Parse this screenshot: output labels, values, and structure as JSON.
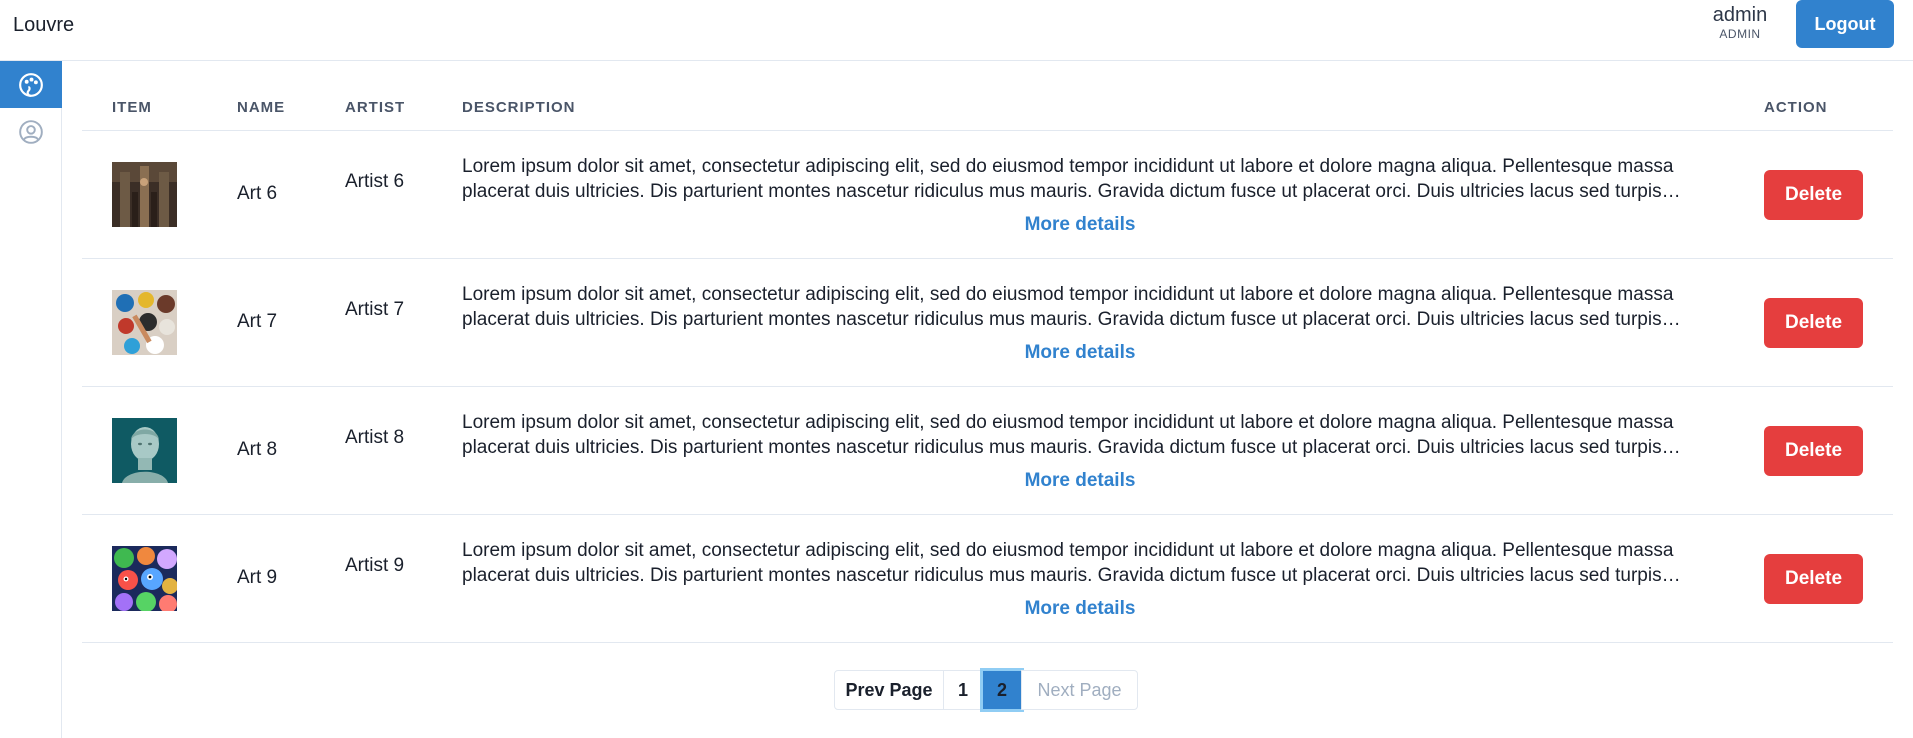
{
  "header": {
    "brand": "Louvre",
    "user_name": "admin",
    "user_role": "ADMIN",
    "logout_label": "Logout"
  },
  "sidebar": {
    "items": [
      {
        "icon": "palette-icon",
        "active": true
      },
      {
        "icon": "user-circle-icon",
        "active": false
      }
    ]
  },
  "table": {
    "columns": [
      "ITEM",
      "NAME",
      "ARTIST",
      "DESCRIPTION",
      "ACTION"
    ],
    "rows": [
      {
        "image": "art-6-thumbnail",
        "name": "Art 6",
        "artist": "Artist 6",
        "description": "Lorem ipsum dolor sit amet, consectetur adipiscing elit, sed do eiusmod tempor incididunt ut labore et dolore magna aliqua. Pellentesque massa placerat duis ultricies. Dis parturient montes nascetur ridiculus mus mauris. Gravida dictum fusce ut placerat orci. Duis ultricies lacus sed turpis tincidunt id aliquet risus.",
        "more_label": "More details",
        "action_label": "Delete"
      },
      {
        "image": "art-7-thumbnail",
        "name": "Art 7",
        "artist": "Artist 7",
        "description": "Lorem ipsum dolor sit amet, consectetur adipiscing elit, sed do eiusmod tempor incididunt ut labore et dolore magna aliqua. Pellentesque massa placerat duis ultricies. Dis parturient montes nascetur ridiculus mus mauris. Gravida dictum fusce ut placerat orci. Duis ultricies lacus sed turpis tincidunt id aliquet risus.",
        "more_label": "More details",
        "action_label": "Delete"
      },
      {
        "image": "art-8-thumbnail",
        "name": "Art 8",
        "artist": "Artist 8",
        "description": "Lorem ipsum dolor sit amet, consectetur adipiscing elit, sed do eiusmod tempor incididunt ut labore et dolore magna aliqua. Pellentesque massa placerat duis ultricies. Dis parturient montes nascetur ridiculus mus mauris. Gravida dictum fusce ut placerat orci. Duis ultricies lacus sed turpis tincidunt id aliquet risus.",
        "more_label": "More details",
        "action_label": "Delete"
      },
      {
        "image": "art-9-thumbnail",
        "name": "Art 9",
        "artist": "Artist 9",
        "description": "Lorem ipsum dolor sit amet, consectetur adipiscing elit, sed do eiusmod tempor incididunt ut labore et dolore magna aliqua. Pellentesque massa placerat duis ultricies. Dis parturient montes nascetur ridiculus mus mauris. Gravida dictum fusce ut placerat orci. Duis ultricies lacus sed turpis tincidunt id aliquet risus.",
        "more_label": "More details",
        "action_label": "Delete"
      }
    ]
  },
  "pagination": {
    "prev_label": "Prev Page",
    "pages": [
      "1",
      "2"
    ],
    "current_page": "2",
    "next_label": "Next Page"
  },
  "colors": {
    "primary": "#3182ce",
    "danger": "#e53e3e",
    "border": "#e2e8f0"
  }
}
